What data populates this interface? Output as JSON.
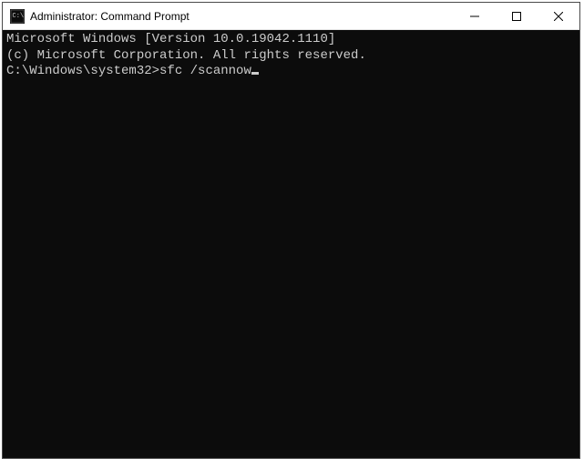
{
  "window": {
    "title": "Administrator: Command Prompt"
  },
  "terminal": {
    "line1": "Microsoft Windows [Version 10.0.19042.1110]",
    "line2": "(c) Microsoft Corporation. All rights reserved.",
    "blank": "",
    "prompt": "C:\\Windows\\system32>",
    "command": "sfc /scannow"
  },
  "icons": {
    "app": "cmd-icon",
    "minimize": "minimize-icon",
    "maximize": "maximize-icon",
    "close": "close-icon"
  }
}
